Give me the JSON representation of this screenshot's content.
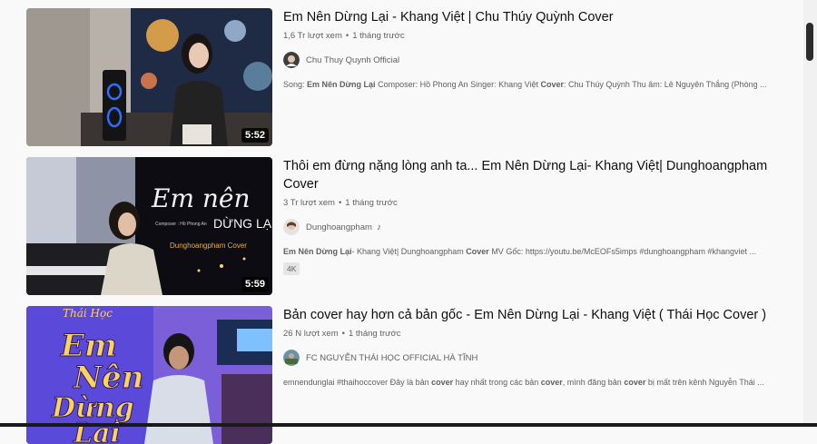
{
  "videos": [
    {
      "title": "Em Nên Dừng Lại - Khang Việt | Chu Thúy Quỳnh Cover",
      "views": "1,6 Tr lượt xem",
      "age": "1 tháng trước",
      "channel": "Chu Thuy Quynh Official",
      "duration": "5:52",
      "desc_parts": [
        {
          "t": "Song: ",
          "b": false
        },
        {
          "t": "Em Nên Dừng Lại",
          "b": true
        },
        {
          "t": " Composer: Hồ Phong An Singer: Khang Việt ",
          "b": false
        },
        {
          "t": "Cover",
          "b": true
        },
        {
          "t": ": Chu Thúy Quỳnh Thu âm: Lê Nguyên Thắng (Phòng ...",
          "b": false
        }
      ]
    },
    {
      "title": "Thôi em đừng nặng lòng anh ta... Em Nên Dừng Lại- Khang Việt| Dunghoangpham Cover",
      "views": "3 Tr lượt xem",
      "age": "1 tháng trước",
      "channel": "Dunghoangpham",
      "channel_icon": "music-note-icon",
      "duration": "5:59",
      "thumb_text": {
        "main": "Em nên",
        "sub": "DỪNG LẠI",
        "composer": "Composer : Hồ Phong An",
        "cover": "Dunghoangpham Cover"
      },
      "desc_parts": [
        {
          "t": "Em Nên Dừng Lại",
          "b": true
        },
        {
          "t": "- Khang Việt| Dunghoangpham ",
          "b": false
        },
        {
          "t": "Cover",
          "b": true
        },
        {
          "t": " MV Gốc: https://youtu.be/McEOFs5imps #dunghoangpham #khangviet ...",
          "b": false
        }
      ],
      "badge": "4K"
    },
    {
      "title": "Bản cover hay hơn cả bản gốc - Em Nên Dừng Lại - Khang Việt ( Thái Học Cover )",
      "views": "26 N lượt xem",
      "age": "1 tháng trước",
      "channel": "FC NGUYỄN THÁI HỌC OFFICIAL HÀ TĨNH",
      "thumb_text": {
        "top": "Thái Học",
        "l1": "Em",
        "l2": "Nên",
        "l3": "Dừng",
        "l4": "Lại"
      },
      "desc_parts": [
        {
          "t": "emnendunglai #thaihoccover Đây là bản ",
          "b": false
        },
        {
          "t": "cover",
          "b": true
        },
        {
          "t": " hay nhất trong các bản ",
          "b": false
        },
        {
          "t": "cover",
          "b": true
        },
        {
          "t": ", mình đăng bản ",
          "b": false
        },
        {
          "t": "cover",
          "b": true
        },
        {
          "t": " bị mất trên kênh Nguyễn Thái ...",
          "b": false
        }
      ]
    }
  ]
}
